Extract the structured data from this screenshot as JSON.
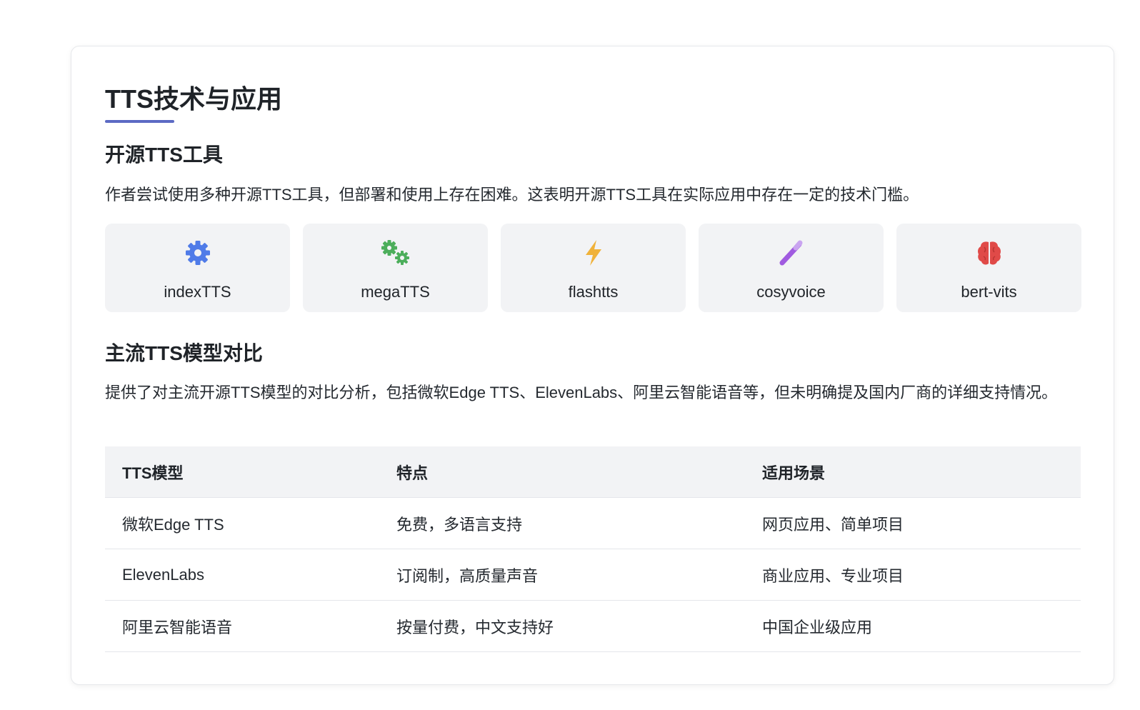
{
  "page": {
    "title": "TTS技术与应用"
  },
  "open_source": {
    "heading": "开源TTS工具",
    "description": "作者尝试使用多种开源TTS工具，但部署和使用上存在困难。这表明开源TTS工具在实际应用中存在一定的技术门槛。",
    "tools": [
      {
        "label": "indexTTS",
        "icon": "gear-icon",
        "color": "#4f7be8"
      },
      {
        "label": "megaTTS",
        "icon": "gears-icon",
        "color": "#4cae5b"
      },
      {
        "label": "flashtts",
        "icon": "lightning-icon",
        "color": "#f0b23a"
      },
      {
        "label": "cosyvoice",
        "icon": "magic-wand-icon",
        "color": "#a05be0"
      },
      {
        "label": "bert-vits",
        "icon": "brain-icon",
        "color": "#e04a48"
      }
    ]
  },
  "comparison": {
    "heading": "主流TTS模型对比",
    "description": "提供了对主流开源TTS模型的对比分析，包括微软Edge TTS、ElevenLabs、阿里云智能语音等，但未明确提及国内厂商的详细支持情况。",
    "columns": [
      "TTS模型",
      "特点",
      "适用场景"
    ],
    "rows": [
      [
        "微软Edge TTS",
        "免费，多语言支持",
        "网页应用、简单项目"
      ],
      [
        "ElevenLabs",
        "订阅制，高质量声音",
        "商业应用、专业项目"
      ],
      [
        "阿里云智能语音",
        "按量付费，中文支持好",
        "中国企业级应用"
      ]
    ]
  },
  "colors": {
    "accent": "#5c6ac4",
    "card_bg": "#f2f3f5"
  }
}
